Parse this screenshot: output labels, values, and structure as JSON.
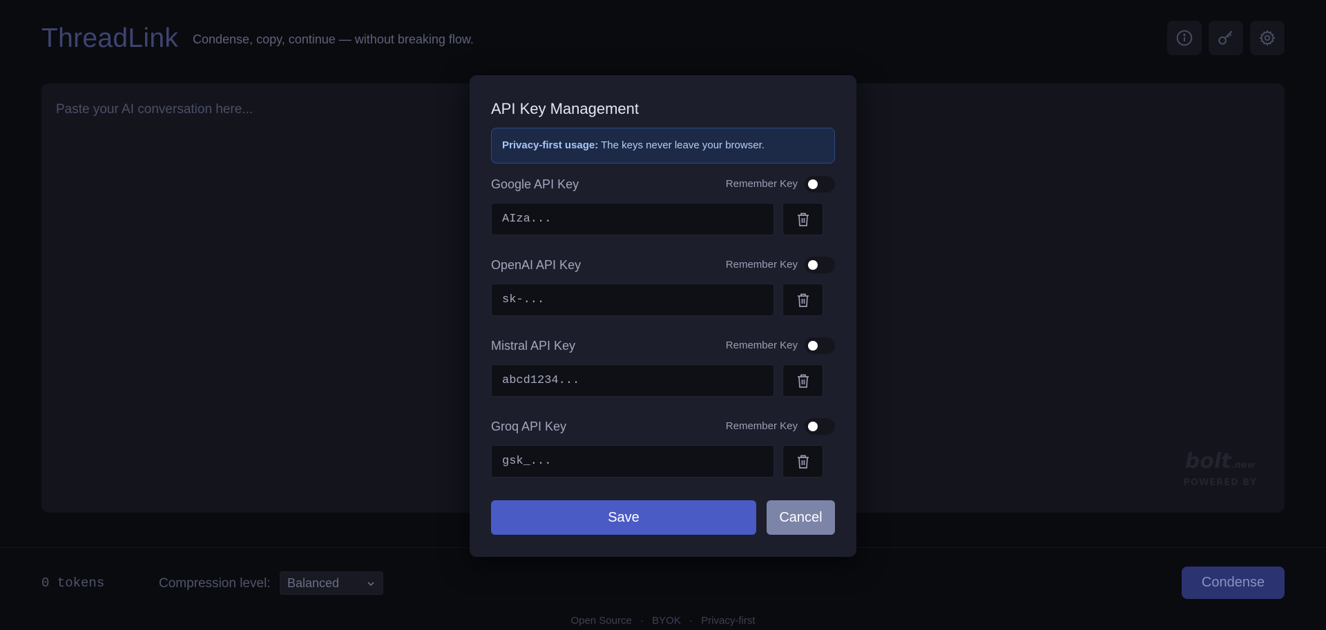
{
  "header": {
    "title": "ThreadLink",
    "tagline": "Condense, copy, continue — without breaking flow.",
    "icons": [
      "info-icon",
      "key-icon",
      "gear-icon"
    ]
  },
  "editor": {
    "placeholder": "Paste your AI conversation here..."
  },
  "badge": {
    "brand": "bolt",
    "brand_suffix": ".new",
    "powered_by": "POWERED BY"
  },
  "footer": {
    "tokens": "0 tokens",
    "compression_label": "Compression level:",
    "compression_value": "Balanced",
    "condense_label": "Condense",
    "links": [
      "Open Source",
      "BYOK",
      "Privacy-first"
    ],
    "separator": "·"
  },
  "modal": {
    "title": "API Key Management",
    "privacy_strong": "Privacy-first usage:",
    "privacy_text": " The keys never leave your browser.",
    "keys": [
      {
        "label": "Google API Key",
        "remember_label": "Remember Key",
        "remember": false,
        "placeholder": "AIza..."
      },
      {
        "label": "OpenAI API Key",
        "remember_label": "Remember Key",
        "remember": false,
        "placeholder": "sk-..."
      },
      {
        "label": "Mistral API Key",
        "remember_label": "Remember Key",
        "remember": false,
        "placeholder": "abcd1234..."
      },
      {
        "label": "Groq API Key",
        "remember_label": "Remember Key",
        "remember": false,
        "placeholder": "gsk_..."
      }
    ],
    "save_label": "Save",
    "cancel_label": "Cancel"
  },
  "colors": {
    "background": "#0a0b0f",
    "modal_bg": "#1c1e2b",
    "primary": "#4a5bc5",
    "secondary": "#7c84a8",
    "info_bg": "#1c2a48",
    "info_border": "#2d4a82"
  }
}
